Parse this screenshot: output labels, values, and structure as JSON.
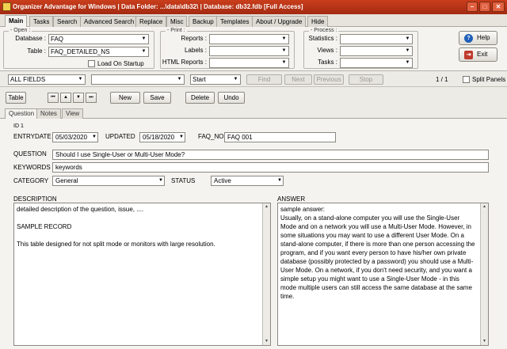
{
  "window": {
    "title": "Organizer Advantage for Windows | Data Folder: ...\\data\\db32\\ | Database: db32.fdb [Full Access]"
  },
  "menu_tabs": [
    "Main",
    "Tasks",
    "Search",
    "Advanced Search",
    "Replace",
    "Misc",
    "Backup",
    "Templates",
    "About / Upgrade",
    "Hide"
  ],
  "ribbon": {
    "open": {
      "group_label": "Open",
      "database_label": "Database :",
      "database_value": "FAQ",
      "table_label": "Table :",
      "table_value": "FAQ_DETAILED_NS",
      "load_on_startup_label": "Load On Startup"
    },
    "print": {
      "group_label": "Print",
      "reports_label": "Reports :",
      "labels_label": "Labels :",
      "html_reports_label": "HTML Reports :"
    },
    "process": {
      "group_label": "Process",
      "statistics_label": "Statistics :",
      "views_label": "Views :",
      "tasks_label": "Tasks :"
    },
    "help_label": "Help",
    "exit_label": "Exit"
  },
  "searchbar": {
    "field_value": "ALL FIELDS",
    "search_value": "",
    "mode_value": "Start",
    "find_label": "Find",
    "next_label": "Next",
    "previous_label": "Previous",
    "stop_label": "Stop",
    "record_counter": "1 / 1",
    "split_panels_label": "Split Panels"
  },
  "toolbar": {
    "table_label": "Table",
    "new_label": "New",
    "save_label": "Save",
    "delete_label": "Delete",
    "undo_label": "Undo"
  },
  "sub_tabs": [
    "Question",
    "Notes",
    "View"
  ],
  "record": {
    "id_label": "ID 1",
    "entrydate_label": "ENTRYDATE",
    "entrydate_value": "05/03/2020",
    "updated_label": "UPDATED",
    "updated_value": "05/18/2020",
    "faq_no_label": "FAQ_NO",
    "faq_no_value": "FAQ 001",
    "question_label": "QUESTION",
    "question_value": "Should I use Single-User or Multi-User Mode?",
    "keywords_label": "KEYWORDS",
    "keywords_value": "keywords",
    "category_label": "CATEGORY",
    "category_value": "General",
    "status_label": "STATUS",
    "status_value": "Active",
    "description_label": "DESCRIPTION",
    "description_lines": [
      "detailed description of the question, issue, ....",
      "",
      "SAMPLE RECORD",
      "",
      "This table designed for not split mode or monitors with large resolution."
    ],
    "answer_label": "ANSWER",
    "answer_lines": [
      "sample answer:",
      "Usually, on a stand-alone computer you will use the Single-User Mode and on a network you will use a Multi-User Mode. However, in some situations you may want to use a different User Mode. On a stand-alone computer, if there is more than one person accessing the program, and if you want every person to have his/her own private database (possibly protected by a password) you should use a Multi-User Mode. On a network, if you don't need security, and you want a simple setup you might want to use a Single-User Mode - in this mode multiple users can still access the same database at the same time."
    ]
  },
  "colors": {
    "titlebar": "#b8341a",
    "accent_blue": "#1f5fb8",
    "exit_red": "#c0392b"
  }
}
